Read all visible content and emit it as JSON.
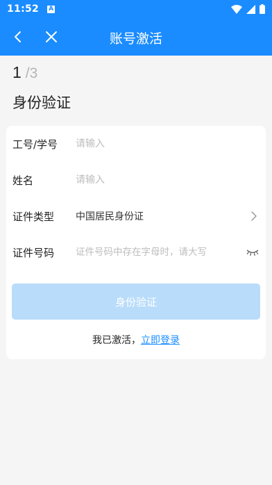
{
  "status_bar": {
    "time": "11:52",
    "app_icon_glyph": "A",
    "icons": [
      "wifi-icon",
      "signal-icon",
      "battery-icon"
    ]
  },
  "nav": {
    "title": "账号激活",
    "back_icon": "chevron-left-icon",
    "close_icon": "close-icon"
  },
  "step": {
    "current": "1",
    "total": "/3"
  },
  "page_title": "身份验证",
  "form": {
    "fields": [
      {
        "label": "工号/学号",
        "placeholder": "请输入",
        "value": ""
      },
      {
        "label": "姓名",
        "placeholder": "请输入",
        "value": ""
      },
      {
        "label": "证件类型",
        "value": "中国居民身份证",
        "icon": "chevron-right-icon"
      },
      {
        "label": "证件号码",
        "placeholder": "证件号码中存在字母时，请大写",
        "value": "",
        "icon": "eye-closed-icon"
      }
    ],
    "submit_label": "身份验证"
  },
  "footer": {
    "prompt": "我已激活，",
    "login_link": "立即登录"
  },
  "colors": {
    "primary": "#1a8cff",
    "button_disabled": "#b9dcfb",
    "background": "#f5f5f5"
  }
}
